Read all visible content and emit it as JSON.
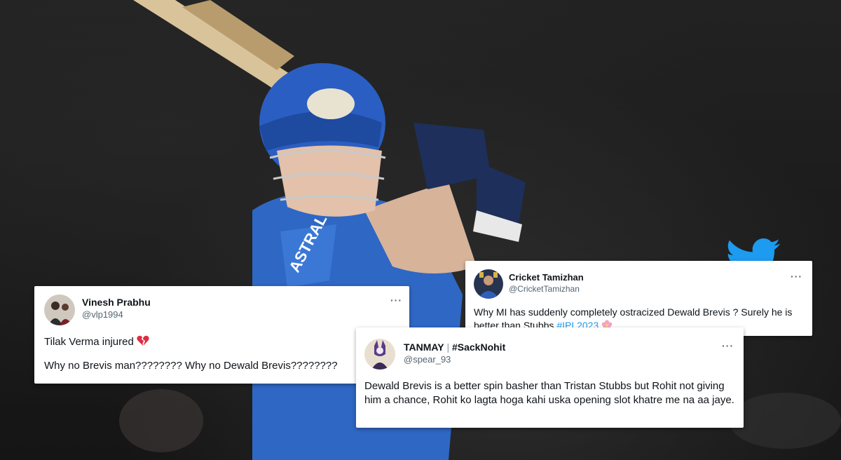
{
  "tweets": [
    {
      "name": "Vinesh Prabhu",
      "handle": "@vlp1994",
      "more": "···",
      "line1": "Tilak Verma injured",
      "line2": "Why no Brevis man???????? Why no Dewald Brevis????????",
      "emoji": "broken-heart"
    },
    {
      "name": "Cricket Tamizhan",
      "handle": "@CricketTamizhan",
      "more": "···",
      "text_before": "Why MI has suddenly completely ostracized Dewald Brevis ? Surely he is better than Stubbs ",
      "hashtag": "#IPL2023",
      "emoji": "flower"
    },
    {
      "name_part1": "TANMAY",
      "name_sep": " | ",
      "name_part2": "#SackNohit",
      "handle": "@spear_93",
      "more": "···",
      "text": "Dewald Brevis is a better spin basher than Tristan Stubbs but Rohit not giving him a chance, Rohit ko lagta hoga kahi uska opening slot khatre me na aa jaye."
    }
  ],
  "icons": {
    "brand": "twitter-bird-icon"
  },
  "colors": {
    "accent": "#1d9bf0",
    "jersey": "#2f67c4"
  }
}
